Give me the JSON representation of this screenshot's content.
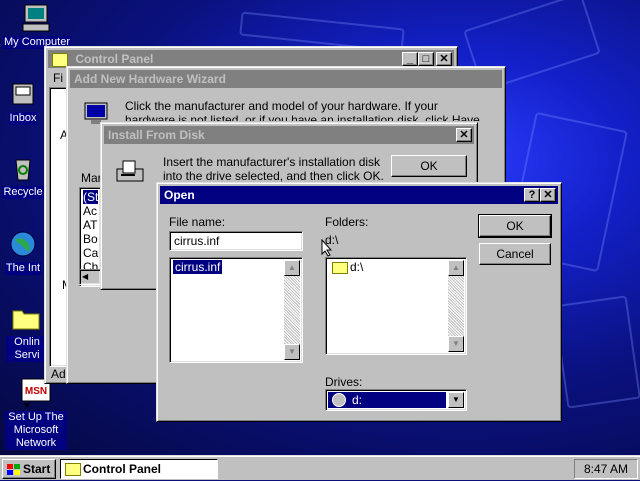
{
  "desktop": {
    "icons": [
      {
        "label": "My Computer",
        "icon": "my-computer-icon"
      },
      {
        "label": "Inbox",
        "icon": "inbox-icon"
      },
      {
        "label": "Recycle",
        "icon": "recycle-bin-icon"
      },
      {
        "label": "The Int",
        "icon": "internet-icon"
      },
      {
        "label": "Onlin Servi",
        "icon": "online-services-folder-icon"
      },
      {
        "label": "Set Up The Microsoft Network",
        "icon": "msn-setup-icon"
      }
    ],
    "icon_letter": "MSN"
  },
  "control_panel": {
    "title": "Control Panel",
    "menu_fragment": "Fi",
    "side_fragments": [
      "A",
      "M"
    ],
    "status_fragment": "Ad"
  },
  "wizard": {
    "title": "Add New Hardware Wizard",
    "instruction": "Click the manufacturer and model of your hardware. If your hardware is not listed, or if you have an installation disk, click Have Disk.",
    "manufacturers_label": "Mar",
    "manufacturers": [
      "(St",
      "Ac",
      "AT",
      "Bo",
      "Ca",
      "Ch"
    ]
  },
  "install_from_disk": {
    "title": "Install From Disk",
    "message": "Insert the manufacturer's installation disk into the drive selected, and then click OK.",
    "ok_label": "OK"
  },
  "open_dialog": {
    "title": "Open",
    "help_button": "?",
    "close_button": "✕",
    "file_name_label": "File name:",
    "file_name_value": "cirrus.inf",
    "files": [
      "cirrus.inf"
    ],
    "folders_label": "Folders:",
    "current_folder": "d:\\",
    "folder_items": [
      "d:\\"
    ],
    "drives_label": "Drives:",
    "drive_selected": "d:",
    "ok_label": "OK",
    "cancel_label": "Cancel"
  },
  "taskbar": {
    "start_label": "Start",
    "task_label": "Control Panel",
    "clock": "8:47 AM"
  },
  "colors": {
    "title_active": "#000080",
    "title_inactive": "#808080",
    "face": "#c0c0c0",
    "desktop": "#1320c8"
  }
}
